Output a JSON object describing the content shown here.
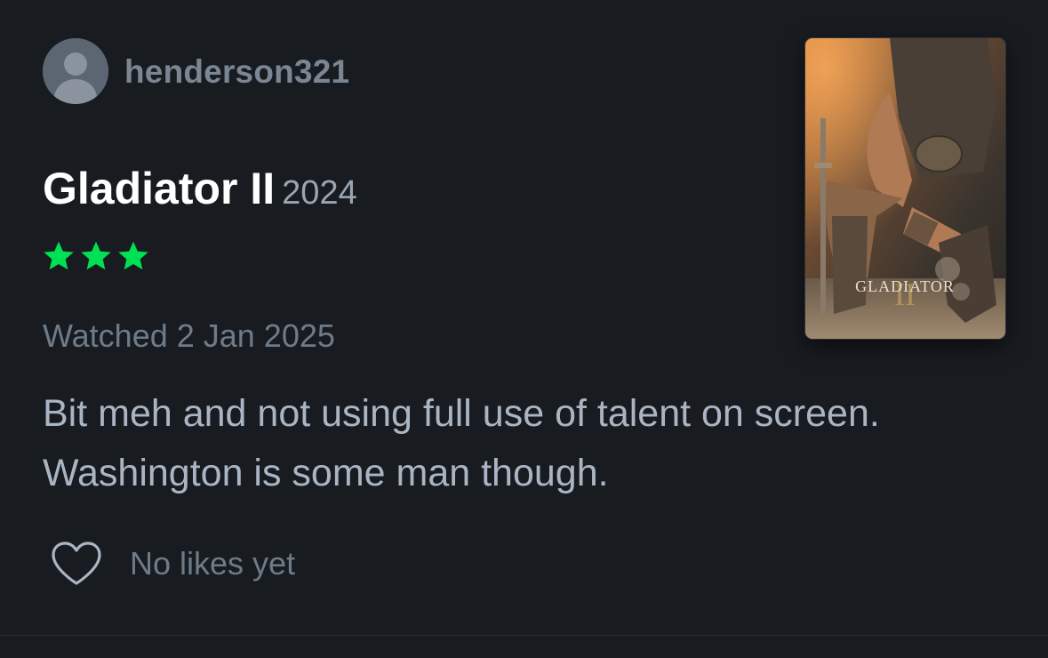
{
  "user": {
    "username": "henderson321",
    "avatar_icon": "default-avatar-icon"
  },
  "film": {
    "title": "Gladiator II",
    "year": "2024",
    "poster_title": "GLADIATOR",
    "poster_numeral": "II"
  },
  "rating": {
    "stars": 3,
    "max_stars": 5,
    "color": "#40bcf4"
  },
  "watched_label": "Watched 2 Jan 2025",
  "review_text": "Bit meh and not using full use of talent on screen. Washington is some man though.",
  "likes": {
    "label": "No likes yet",
    "icon": "heart-icon"
  },
  "colors": {
    "background": "#181b20",
    "star": "#00e054",
    "username": "#7a8694",
    "body_text": "#aab5c3"
  }
}
